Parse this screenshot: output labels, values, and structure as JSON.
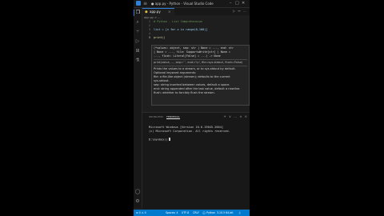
{
  "window": {
    "title": "● app.py - Python - Visual Studio Code",
    "menu_icon": "hamburger-icon",
    "controls": [
      "minimize-icon",
      "maximize-icon",
      "close-icon"
    ]
  },
  "activity_bar": {
    "items": [
      "explorer-icon",
      "search-icon",
      "source-control-icon",
      "run-debug-icon",
      "extensions-icon",
      "testing-icon"
    ],
    "bottom": [
      "account-icon",
      "settings-gear-icon"
    ]
  },
  "tabs": [
    {
      "icon": "py",
      "label": "app.py",
      "close": "×"
    }
  ],
  "tab_actions": "▷ ↔ …",
  "breadcrumb": "app.py > …",
  "editor": {
    "lines": [
      {
        "n": "1",
        "text": "# Python - List Comprehension"
      },
      {
        "n": "2",
        "text": ""
      },
      {
        "n": "3",
        "text": "list = [x for x in range(0,100)]"
      },
      {
        "n": "4",
        "text": ""
      },
      {
        "n": "5",
        "text": "print()"
      }
    ]
  },
  "hover": {
    "signature": [
      "(*values: object, sep: str | None = ..., end: str",
      "| None = ..., file: SupportsWrite[str] | None =",
      "..., flush: Literal[False] = ...) -> None"
    ],
    "short_sig": "print(value, ..., sep=' ', end='\\n', file=sys.stdout, flush=False)",
    "doc": [
      "Prints the values to a stream, or to sys.stdout by default.",
      "Optional keyword arguments:",
      "file: a file-like object (stream); defaults to the current",
      "sys.stdout.",
      "sep: string inserted between values, default a space.",
      "end: string appended after the last value, default a newline.",
      "flush: whether to forcibly flush the stream."
    ]
  },
  "panel": {
    "tabs": [
      "PROBLEMS",
      "TERMINAL"
    ],
    "active_tab": "TERMINAL",
    "actions": "+ ∨ … ∧ ×",
    "terminal_lines": [
      "Microsoft Windows [Version 10.0.19045.2604]",
      "(c) Microsoft Corporation. All rights reserved.",
      "",
      "D:\\myvbox()"
    ]
  },
  "status_bar": {
    "left": "⊗ 0 ⚠ 0",
    "items": [
      "Spaces: 4",
      "UTF-8",
      "CRLF",
      "{} Python",
      "3.10.5 64-bit"
    ]
  },
  "colors": {
    "accent": "#007acc",
    "editor_bg": "#1e1e1e",
    "panel_bg": "#181818"
  }
}
